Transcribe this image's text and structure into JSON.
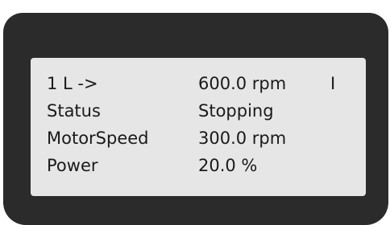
{
  "panel": {
    "rows": [
      {
        "label": "1 L ->",
        "value": "600.0 rpm",
        "flag": "I"
      },
      {
        "label": "Status",
        "value": "Stopping",
        "flag": ""
      },
      {
        "label": "MotorSpeed",
        "value": "300.0 rpm",
        "flag": ""
      },
      {
        "label": "Power",
        "value": "20.0 %",
        "flag": ""
      }
    ]
  },
  "colors": {
    "bezel": "#2b2b2b",
    "screen": "#e6e6e6",
    "text": "#1a1a1a"
  }
}
